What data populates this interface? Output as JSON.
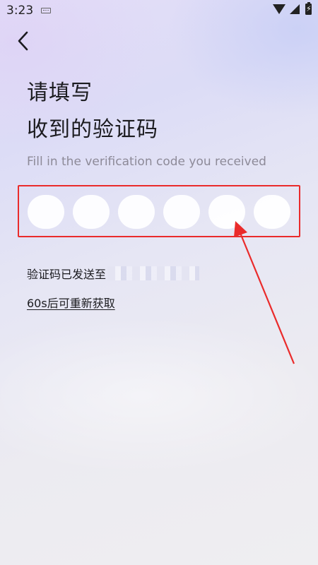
{
  "status_bar": {
    "time": "3:23",
    "icons": [
      "keyboard-icon",
      "wifi-icon",
      "signal-icon",
      "battery-charging-icon"
    ]
  },
  "nav": {
    "back_icon": "chevron-left-icon"
  },
  "header": {
    "title_line1": "请填写",
    "title_line2": "收到的验证码",
    "subtitle": "Fill in the verification code you received"
  },
  "code_input": {
    "length": 6,
    "values": [
      "",
      "",
      "",
      "",
      "",
      ""
    ]
  },
  "sent_info": {
    "label": "验证码已发送至"
  },
  "resend": {
    "label": "60s后可重新获取",
    "countdown_seconds": 60
  },
  "annotation": {
    "color": "#ea2b2b"
  }
}
